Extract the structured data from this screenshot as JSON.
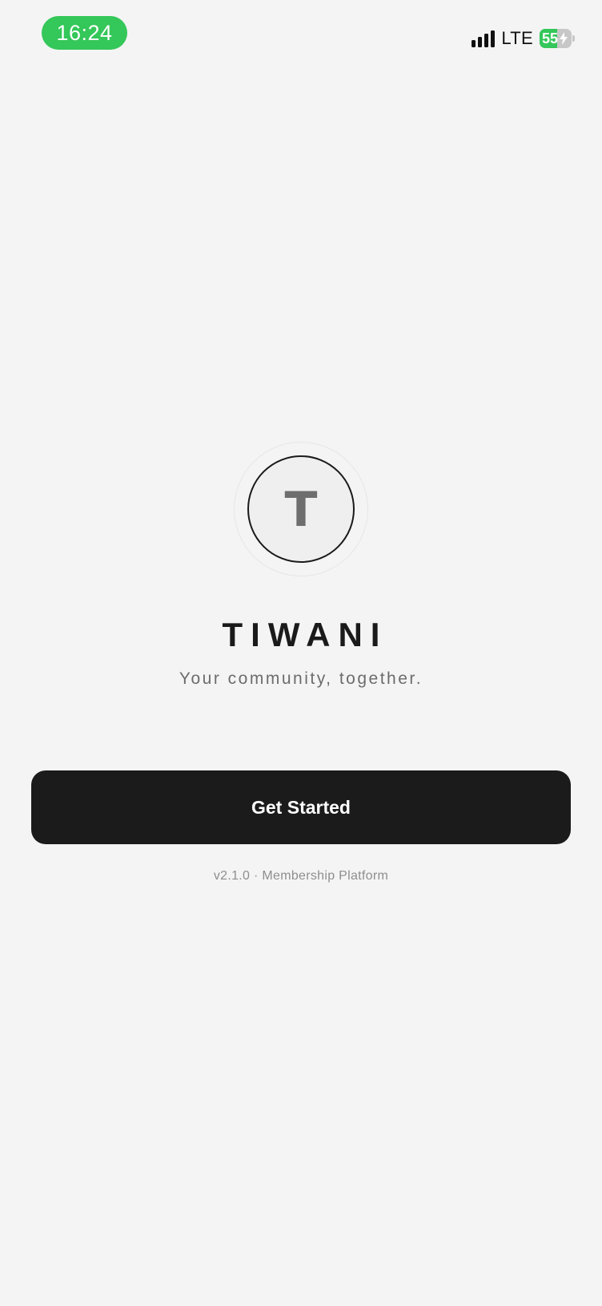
{
  "status_bar": {
    "time": "16:24",
    "network": "LTE",
    "battery_level": "55",
    "battery_fraction": 0.55,
    "signal_icon": "signal-bars-icon",
    "battery_icon": "battery-charging-icon",
    "accent_color": "#34c759"
  },
  "logo": {
    "letter": "T"
  },
  "app": {
    "title": "TIWANI",
    "tagline": "Your community, together."
  },
  "actions": {
    "get_started_label": "Get Started"
  },
  "footer": {
    "version_text": "v2.1.0 · Membership Platform"
  }
}
